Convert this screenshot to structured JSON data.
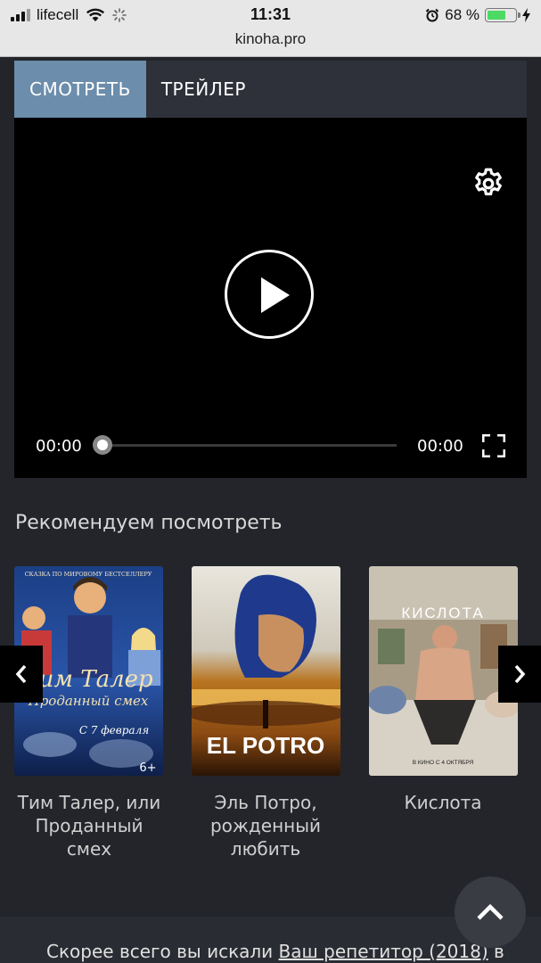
{
  "status_bar": {
    "carrier": "lifecell",
    "time": "11:31",
    "battery": "68 %",
    "battery_level": 0.68
  },
  "browser": {
    "url": "kinoha.pro"
  },
  "player": {
    "tabs": [
      {
        "label": "СМОТРЕТЬ",
        "active": true
      },
      {
        "label": "ТРЕЙЛЕР",
        "active": false
      }
    ],
    "current_time": "00:00",
    "duration": "00:00",
    "progress": 0
  },
  "recommendations": {
    "title": "Рекомендуем посмотреть",
    "items": [
      {
        "title_lines": [
          "Тим Талер, или",
          "Проданный",
          "смех"
        ],
        "poster": {
          "tagline": "СКАЗКА ПО МИРОВОМУ БЕСТСЕЛЛЕРУ",
          "big_title_1": "Тим Талер",
          "big_title_2": "Проданный смех",
          "date": "С 7 февраля",
          "age": "6+"
        }
      },
      {
        "title_lines": [
          "Эль Потро,",
          "рожденный",
          "любить"
        ],
        "poster": {
          "big_title": "EL POTRO"
        }
      },
      {
        "title_lines": [
          "Кислота"
        ],
        "poster": {
          "big_title": "КИСЛОТА",
          "date": "В КИНО С 4 ОКТЯБРЯ"
        }
      }
    ]
  },
  "footer": {
    "text_prefix": "Скорее всего вы искали",
    "link": "Ваш репетитор (2018)",
    "text_suffix": "в"
  },
  "icons": {
    "settings": "gear-icon",
    "play": "play-icon",
    "fullscreen": "fullscreen-icon",
    "prev": "chevron-left-icon",
    "next": "chevron-right-icon",
    "top": "chevron-up-icon"
  },
  "colors": {
    "page_bg": "#23252b",
    "tab_active": "#6c8dab",
    "player_bg": "#000000"
  }
}
